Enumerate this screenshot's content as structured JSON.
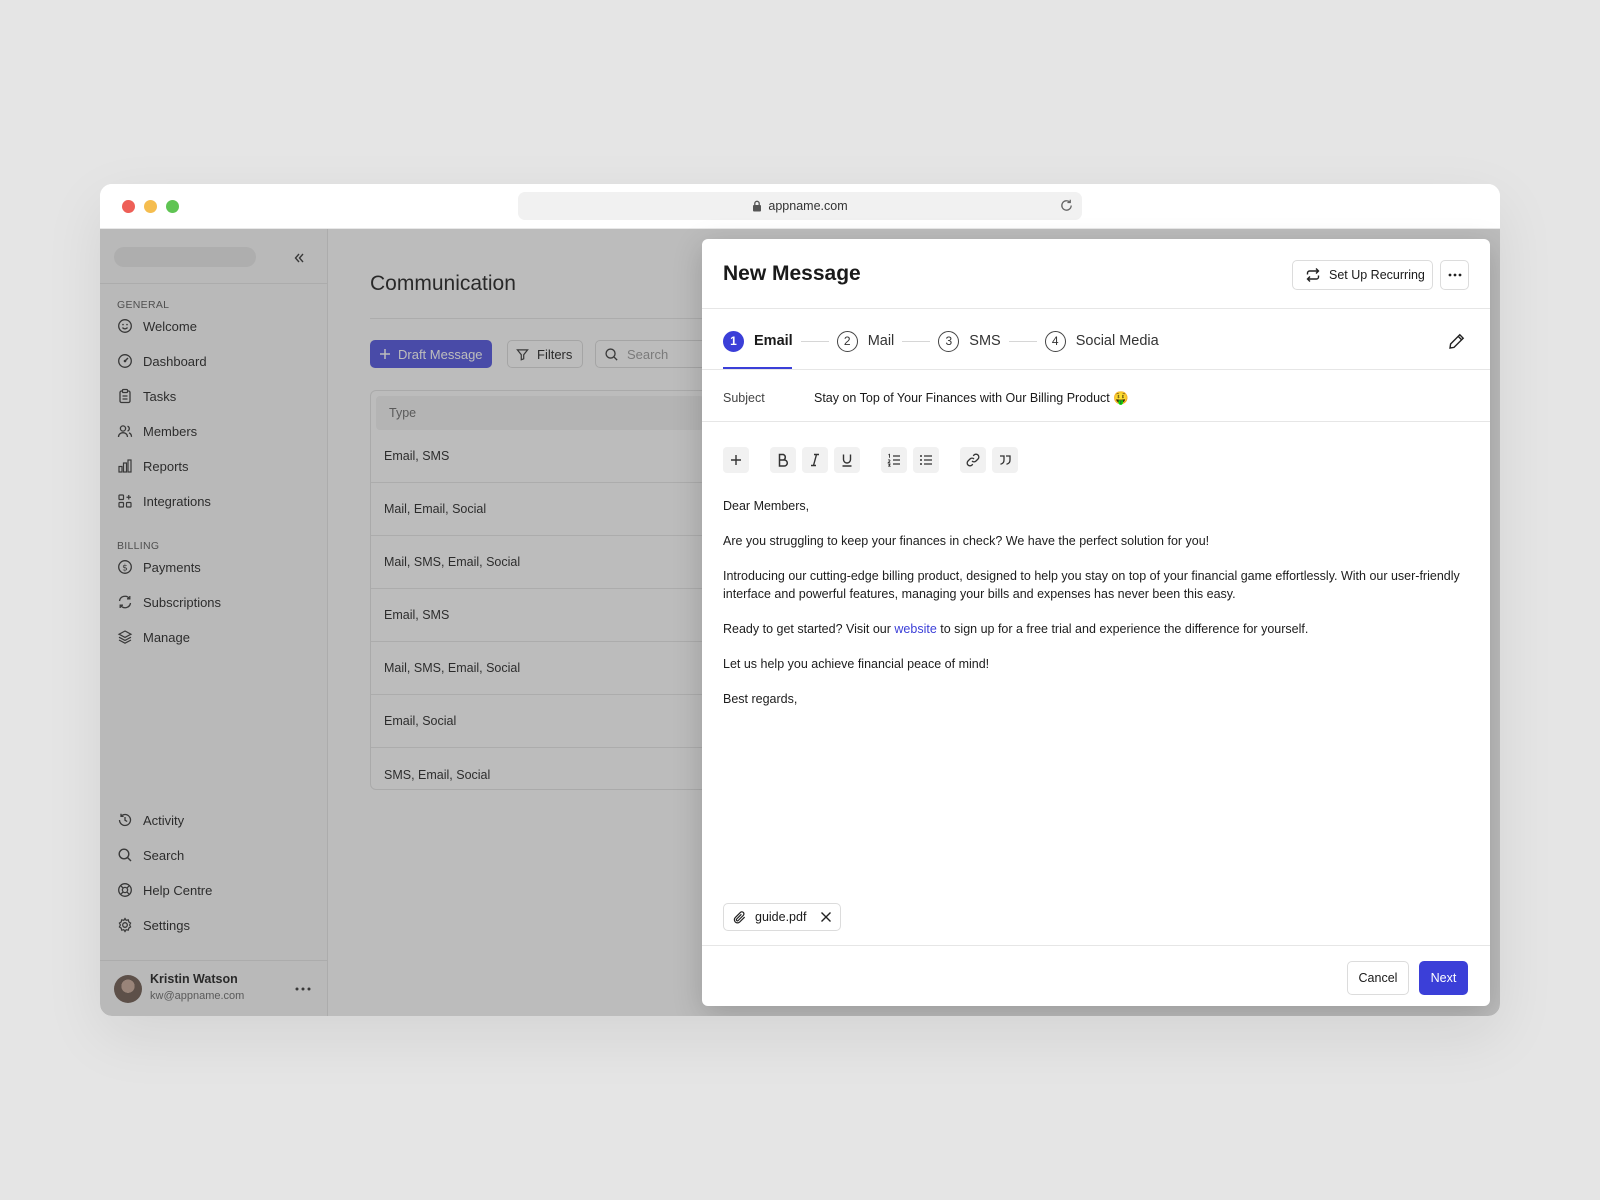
{
  "browser": {
    "url": "appname.com"
  },
  "sidebar": {
    "sections": [
      {
        "label": "GENERAL",
        "items": [
          {
            "label": "Welcome",
            "icon": "smile-icon"
          },
          {
            "label": "Dashboard",
            "icon": "gauge-icon"
          },
          {
            "label": "Tasks",
            "icon": "clipboard-icon"
          },
          {
            "label": "Members",
            "icon": "users-icon"
          },
          {
            "label": "Reports",
            "icon": "bar-chart-icon"
          },
          {
            "label": "Integrations",
            "icon": "grid-plus-icon"
          }
        ]
      },
      {
        "label": "BILLING",
        "items": [
          {
            "label": "Payments",
            "icon": "dollar-circle-icon"
          },
          {
            "label": "Subscriptions",
            "icon": "refresh-icon"
          },
          {
            "label": "Manage",
            "icon": "layers-icon"
          }
        ]
      }
    ],
    "bottom_items": [
      {
        "label": "Activity",
        "icon": "history-icon"
      },
      {
        "label": "Search",
        "icon": "search-icon"
      },
      {
        "label": "Help Centre",
        "icon": "lifebuoy-icon"
      },
      {
        "label": "Settings",
        "icon": "gear-icon"
      }
    ],
    "user": {
      "name": "Kristin Watson",
      "email": "kw@appname.com"
    }
  },
  "main": {
    "title": "Communication",
    "draft_button": "Draft Message",
    "filters_button": "Filters",
    "search_placeholder": "Search",
    "table": {
      "header": "Type",
      "rows": [
        "Email, SMS",
        "Mail, Email, Social",
        "Mail, SMS, Email, Social",
        "Email, SMS",
        "Mail, SMS, Email, Social",
        "Email, Social",
        "SMS, Email, Social"
      ]
    }
  },
  "modal": {
    "title": "New Message",
    "recurring_button": "Set Up Recurring",
    "steps": [
      {
        "num": "1",
        "label": "Email",
        "active": true
      },
      {
        "num": "2",
        "label": "Mail",
        "active": false
      },
      {
        "num": "3",
        "label": "SMS",
        "active": false
      },
      {
        "num": "4",
        "label": "Social Media",
        "active": false
      }
    ],
    "subject_label": "Subject",
    "subject_value": "Stay on Top of Your Finances with Our Billing Product 🤑",
    "body": {
      "greeting": "Dear Members,",
      "p1": "Are you struggling to keep your finances in check? We have the perfect solution for you!",
      "p2": "Introducing our cutting-edge billing product, designed to help you stay on top of your financial game effortlessly. With our user-friendly interface and powerful features, managing your bills and expenses has never been this easy.",
      "p3_before": "Ready to get started? Visit our ",
      "p3_link": "website",
      "p3_after": " to sign up for a free trial and experience the difference for yourself.",
      "p4": "Let us help you achieve financial peace of mind!",
      "signoff": "Best regards,"
    },
    "attachment": "guide.pdf",
    "cancel_button": "Cancel",
    "next_button": "Next"
  },
  "colors": {
    "accent": "#3b3fd8",
    "primary_button": "#4b4fe0"
  }
}
